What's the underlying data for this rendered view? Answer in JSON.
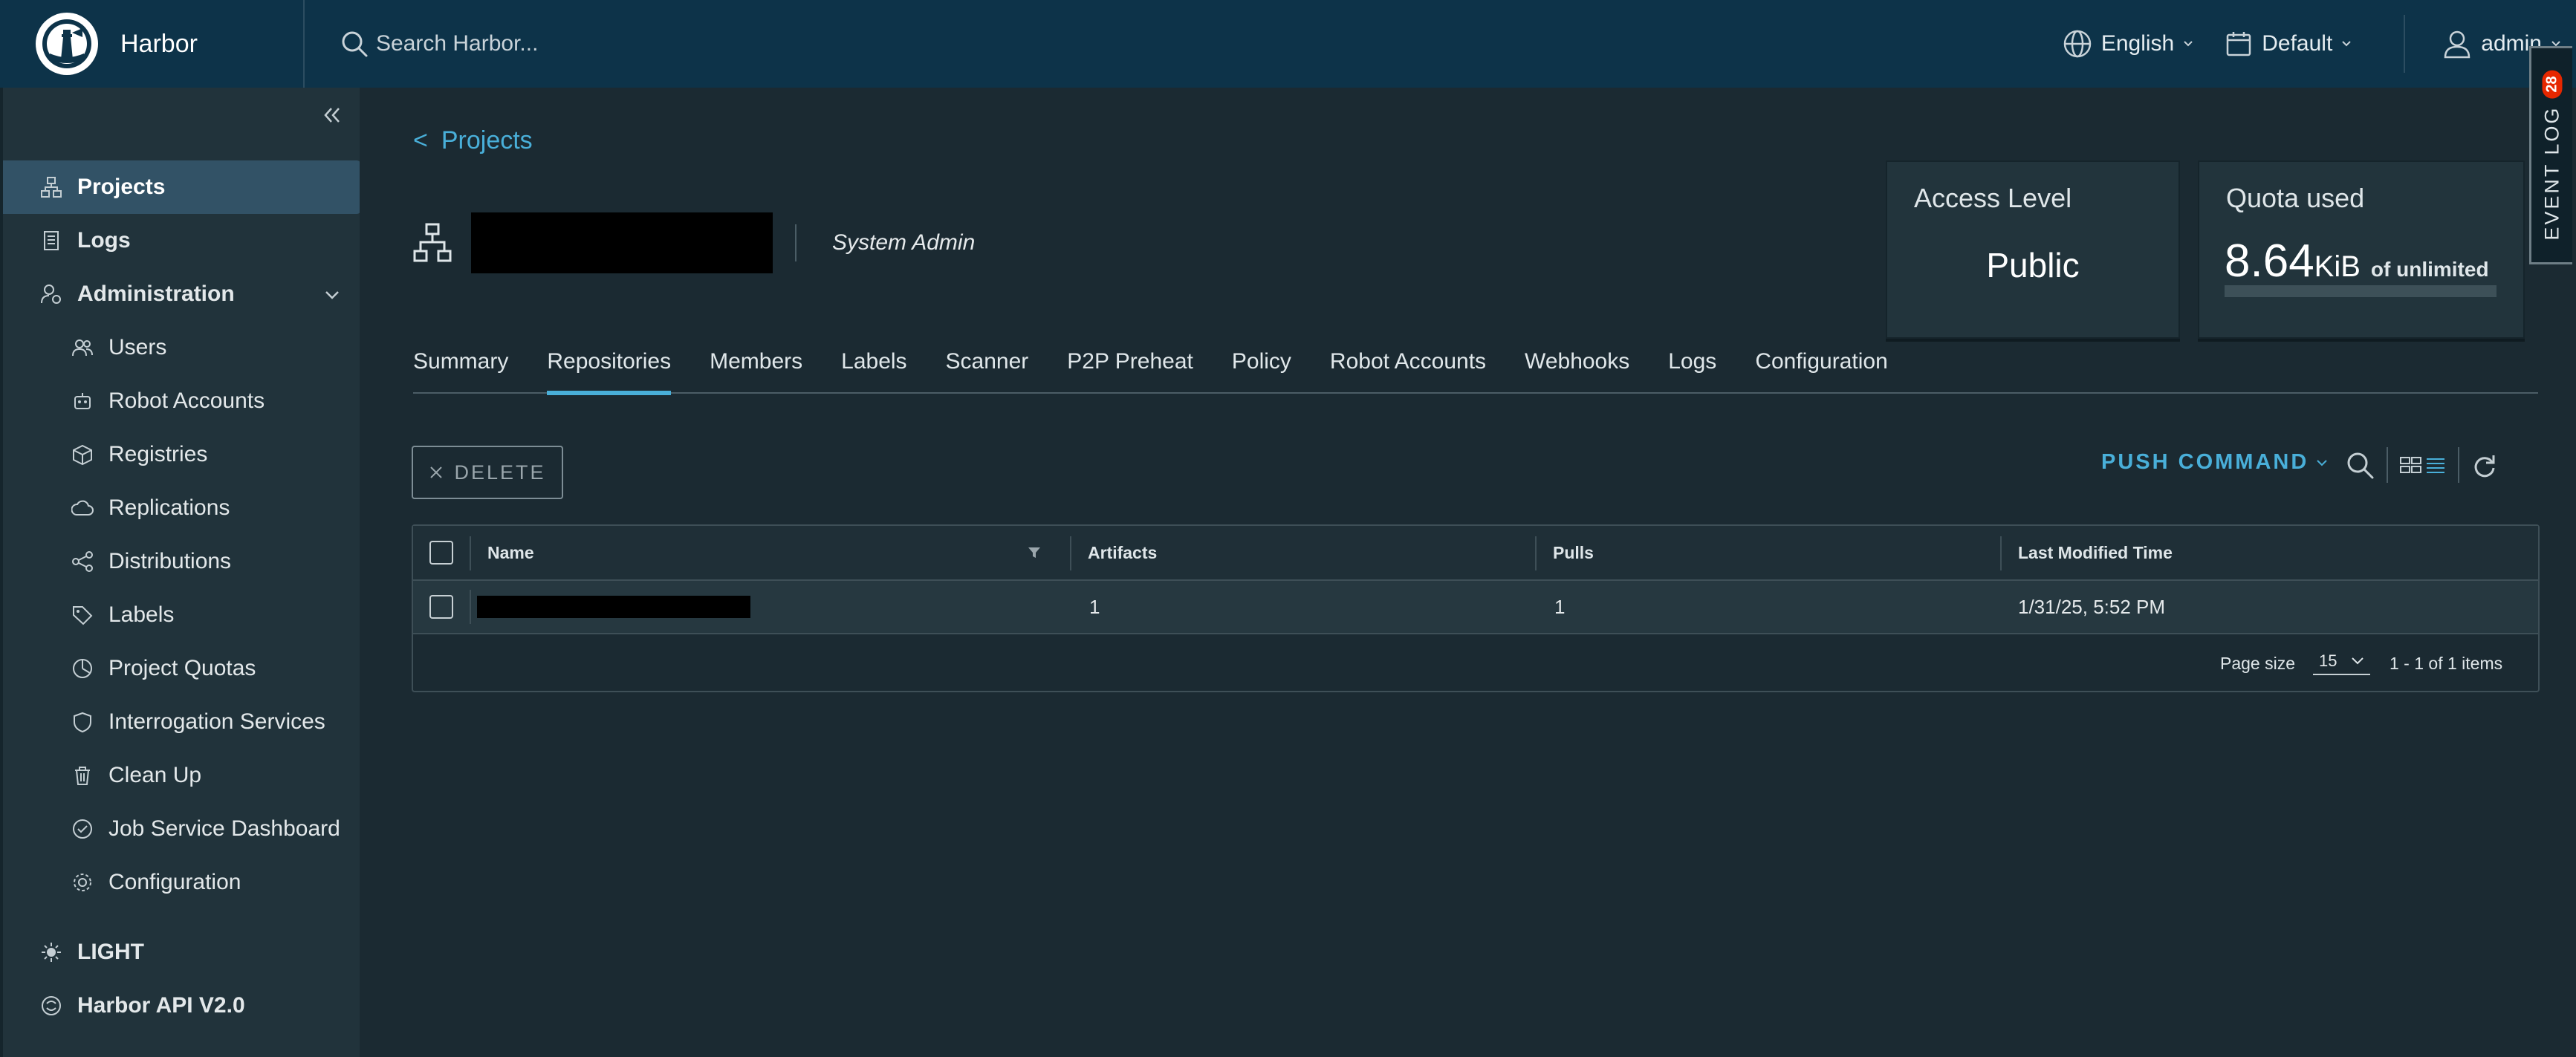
{
  "app": {
    "name": "Harbor"
  },
  "header": {
    "search_placeholder": "Search Harbor...",
    "language": "English",
    "theme_scope": "Default",
    "user": "admin"
  },
  "sidebar": {
    "items": [
      {
        "label": "Projects",
        "icon": "projects-icon",
        "active": true
      },
      {
        "label": "Logs",
        "icon": "logs-icon"
      },
      {
        "label": "Administration",
        "icon": "administration-icon"
      },
      {
        "label": "Users",
        "icon": "users-icon"
      },
      {
        "label": "Robot Accounts",
        "icon": "robot-icon"
      },
      {
        "label": "Registries",
        "icon": "registries-icon"
      },
      {
        "label": "Replications",
        "icon": "replications-icon"
      },
      {
        "label": "Distributions",
        "icon": "distributions-icon"
      },
      {
        "label": "Labels",
        "icon": "labels-icon"
      },
      {
        "label": "Project Quotas",
        "icon": "project-quotas-icon"
      },
      {
        "label": "Interrogation Services",
        "icon": "interrogation-icon"
      },
      {
        "label": "Clean Up",
        "icon": "clean-up-icon"
      },
      {
        "label": "Job Service Dashboard",
        "icon": "job-service-icon"
      },
      {
        "label": "Configuration",
        "icon": "configuration-icon"
      }
    ],
    "theme_toggle": "LIGHT",
    "api_link": "Harbor API V2.0"
  },
  "breadcrumb": {
    "back": "<",
    "label": "Projects"
  },
  "project": {
    "role": "System Admin"
  },
  "access_card": {
    "title": "Access Level",
    "value": "Public"
  },
  "quota_card": {
    "title": "Quota used",
    "number": "8.64",
    "unit": "KiB",
    "suffix": "of unlimited",
    "used_fraction": 0
  },
  "tabs": [
    "Summary",
    "Repositories",
    "Members",
    "Labels",
    "Scanner",
    "P2P Preheat",
    "Policy",
    "Robot Accounts",
    "Webhooks",
    "Logs",
    "Configuration"
  ],
  "active_tab": "Repositories",
  "toolbar": {
    "delete_label": "DELETE",
    "push_command_label": "PUSH COMMAND"
  },
  "table": {
    "columns": [
      "Name",
      "Artifacts",
      "Pulls",
      "Last Modified Time"
    ],
    "rows": [
      {
        "artifacts": "1",
        "pulls": "1",
        "modified": "1/31/25, 5:52 PM"
      }
    ],
    "footer": {
      "page_size_label": "Page size",
      "page_size": "15",
      "summary": "1 - 1 of 1 items"
    }
  },
  "event_log": {
    "label": "EVENT LOG",
    "count": "28"
  }
}
